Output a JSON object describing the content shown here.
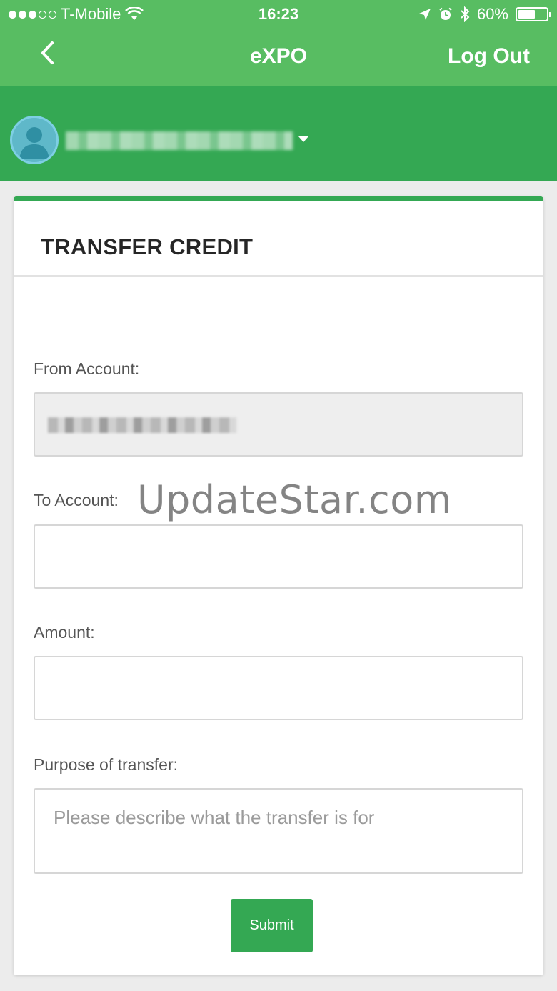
{
  "status_bar": {
    "carrier": "T-Mobile",
    "signal_bars_filled": 3,
    "signal_bars_total": 5,
    "time": "16:23",
    "battery_percent": "60%",
    "battery_level": 0.6,
    "icons": [
      "wifi-icon",
      "location-arrow-icon",
      "alarm-icon",
      "bluetooth-icon",
      "battery-icon"
    ]
  },
  "nav": {
    "back_icon": "chevron-left-icon",
    "title": "eXPO",
    "logout_label": "Log Out"
  },
  "account": {
    "avatar_icon": "user-avatar-icon",
    "name": "",
    "dropdown_icon": "caret-down-icon"
  },
  "form": {
    "title": "TRANSFER CREDIT",
    "from_account": {
      "label": "From Account:",
      "value": ""
    },
    "to_account": {
      "label": "To Account:",
      "value": ""
    },
    "amount": {
      "label": "Amount:",
      "value": ""
    },
    "purpose": {
      "label": "Purpose of transfer:",
      "placeholder": "Please describe what the transfer is for",
      "value": ""
    },
    "submit_label": "Submit"
  },
  "watermark": "UpdateStar.com",
  "colors": {
    "header_green": "#58bd62",
    "account_green": "#34a853",
    "accent": "#34a853",
    "background": "#ececec"
  }
}
